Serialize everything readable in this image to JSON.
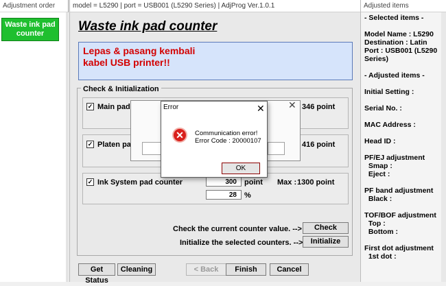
{
  "left_pane": {
    "title": "Adjustment order",
    "item": "Waste ink pad counter"
  },
  "window": {
    "title": "model = L5290 | port = USB001 (L5290 Series) | AdjProg Ver.1.0.1",
    "heading": "Waste ink pad counter",
    "message_lines": [
      "Lepas & pasang kembali",
      "kabel USB printer!!"
    ],
    "group_title": "Check & Initialization",
    "counters": [
      {
        "label": "Main pad",
        "value_fragment": "346 point",
        "checked": "✓"
      },
      {
        "label": "Platen pa",
        "value_fragment": "416 point",
        "checked": "✓"
      },
      {
        "label": "Ink System pad counter",
        "counter_value": "300",
        "unit": "point",
        "max_label": "Max :",
        "max_value": "1300 point",
        "percent": "28",
        "percent_unit": "%",
        "checked": "✓"
      }
    ],
    "check_text": "Check the current counter value. -->",
    "check_button": "Check",
    "init_text": "Initialize the selected counters. -->",
    "init_button": "Initialize",
    "bottom_buttons": {
      "get_status": "Get Status",
      "cleaning": "Cleaning",
      "back": "< Back",
      "finish": "Finish",
      "cancel": "Cancel"
    }
  },
  "background_dialog": {
    "close_symbol": "✕"
  },
  "error_dialog": {
    "title": "Error",
    "close_symbol": "✕",
    "icon": "error-x-icon",
    "message_line1": "Communication error!",
    "message_line2": "Error Code : 20000107",
    "ok_button": "OK"
  },
  "right_pane": {
    "title": "Adjusted items",
    "lines": [
      "- Selected items -",
      "",
      "Model Name : L5290",
      "Destination : Latin",
      "Port : USB001 (L5290",
      "Series)",
      "",
      "- Adjusted items -",
      "",
      "Initial Setting :",
      "",
      "Serial No. :",
      "",
      "MAC Address :",
      "",
      "Head ID :",
      "",
      "PF/EJ adjustment",
      "  Smap :",
      "  Eject :",
      "",
      "PF band adjustment",
      "  Black :",
      "",
      "TOF/BOF adjustment",
      "  Top :",
      "  Bottom :",
      "",
      "First dot adjustment",
      "  1st dot :"
    ]
  },
  "colors": {
    "accent_green": "#1fbf2f",
    "message_red": "#d30000",
    "message_bg": "#d6e4fb",
    "error_red": "#d9201c"
  }
}
